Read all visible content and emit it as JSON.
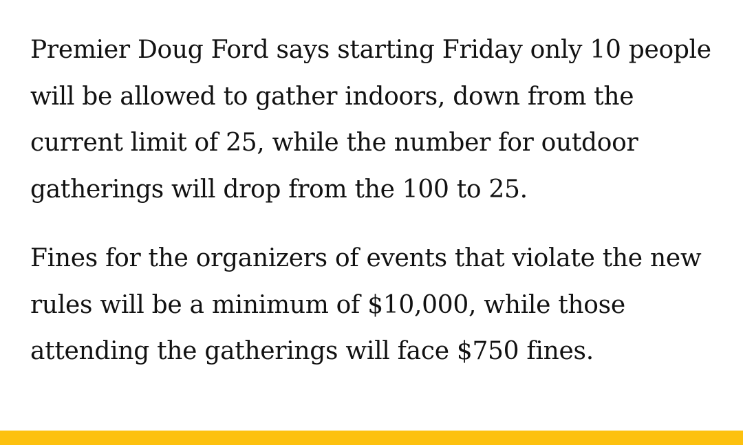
{
  "article": {
    "paragraphs": [
      "Premier Doug Ford says starting Friday only 10 people will be allowed to gather indoors, down from the current limit of 25, while the number for outdoor gatherings will drop from the 100 to 25.",
      "Fines for the organizers of events that violate the new rules will be a minimum of $10,000, while those attending the gatherings will face $750 fines."
    ]
  },
  "colors": {
    "accent": "#fdc10f",
    "text": "#111111",
    "background": "#ffffff"
  }
}
